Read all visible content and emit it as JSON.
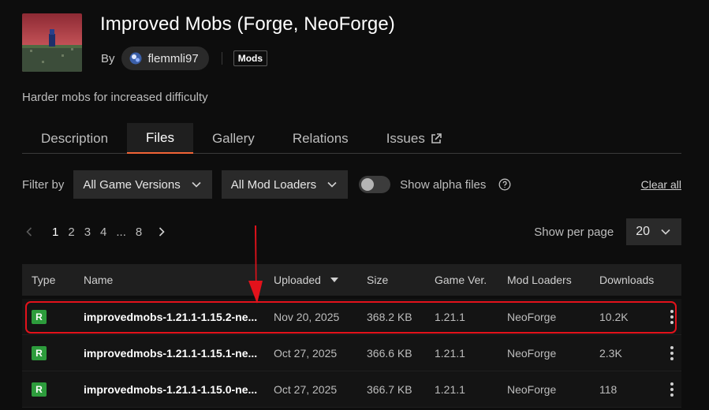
{
  "project": {
    "title": "Improved Mobs (Forge, NeoForge)",
    "by_label": "By",
    "author": "flemmli97",
    "category_badge": "Mods",
    "summary": "Harder mobs for increased difficulty"
  },
  "tabs": [
    {
      "label": "Description"
    },
    {
      "label": "Files"
    },
    {
      "label": "Gallery"
    },
    {
      "label": "Relations"
    },
    {
      "label": "Issues"
    }
  ],
  "filters": {
    "label": "Filter by",
    "game_versions": "All Game Versions",
    "mod_loaders": "All Mod Loaders",
    "alpha_label": "Show alpha files",
    "clear_all": "Clear all"
  },
  "pagination": {
    "pages": [
      "1",
      "2",
      "3",
      "4",
      "...",
      "8"
    ],
    "current": "1",
    "per_page_label": "Show per page",
    "per_page_value": "20"
  },
  "table": {
    "headers": {
      "type": "Type",
      "name": "Name",
      "uploaded": "Uploaded",
      "size": "Size",
      "game_ver": "Game Ver.",
      "mod_loaders": "Mod Loaders",
      "downloads": "Downloads"
    },
    "rows": [
      {
        "type": "R",
        "name": "improvedmobs-1.21.1-1.15.2-ne...",
        "uploaded": "Nov 20, 2025",
        "size": "368.2 KB",
        "game_ver": "1.21.1",
        "loader": "NeoForge",
        "downloads": "10.2K"
      },
      {
        "type": "R",
        "name": "improvedmobs-1.21.1-1.15.1-ne...",
        "uploaded": "Oct 27, 2025",
        "size": "366.6 KB",
        "game_ver": "1.21.1",
        "loader": "NeoForge",
        "downloads": "2.3K"
      },
      {
        "type": "R",
        "name": "improvedmobs-1.21.1-1.15.0-ne...",
        "uploaded": "Oct 27, 2025",
        "size": "366.7 KB",
        "game_ver": "1.21.1",
        "loader": "NeoForge",
        "downloads": "118"
      }
    ]
  },
  "colors": {
    "accent": "#f16436",
    "release_badge": "#2d9c3c",
    "highlight": "#e3121b"
  }
}
